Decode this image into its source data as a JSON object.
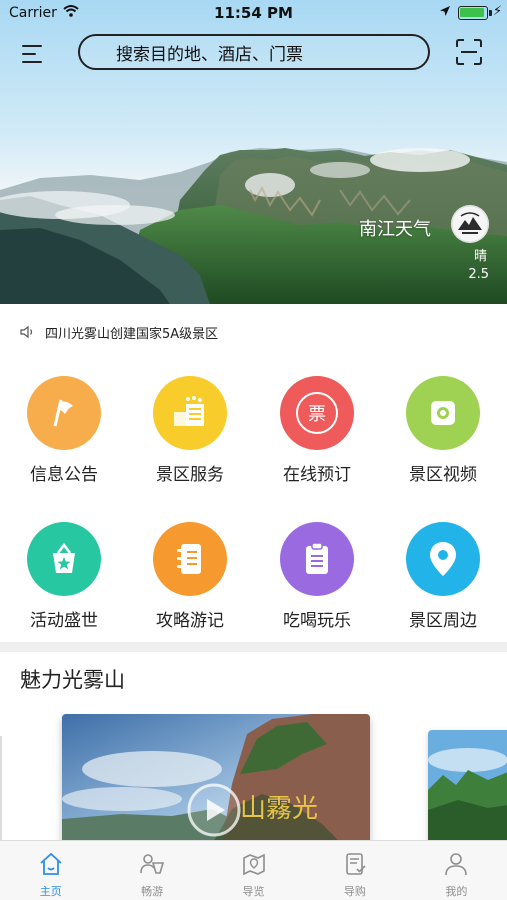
{
  "status_bar": {
    "carrier": "Carrier",
    "time": "11:54 PM"
  },
  "header": {
    "search_placeholder": "搜索目的地、酒店、门票"
  },
  "weather": {
    "city": "南江天气",
    "condition": "晴",
    "temperature": "2.5"
  },
  "notice": {
    "text": "四川光雾山创建国家5A级景区"
  },
  "grid": {
    "items": [
      {
        "label": "信息公告",
        "icon": "flag-icon",
        "color": "#f7ad4b"
      },
      {
        "label": "景区服务",
        "icon": "service-icon",
        "color": "#f8cc2a"
      },
      {
        "label": "在线预订",
        "icon": "ticket-icon",
        "color": "#ef5a5a"
      },
      {
        "label": "景区视频",
        "icon": "video-icon",
        "color": "#9fd253"
      },
      {
        "label": "活动盛世",
        "icon": "gift-icon",
        "color": "#27c7a2"
      },
      {
        "label": "攻略游记",
        "icon": "notebook-icon",
        "color": "#f6992e"
      },
      {
        "label": "吃喝玩乐",
        "icon": "clipboard-icon",
        "color": "#9a6be0"
      },
      {
        "label": "景区周边",
        "icon": "location-pin-icon",
        "color": "#22b4e8"
      }
    ],
    "ticket_char": "票"
  },
  "section": {
    "title": "魅力光雾山"
  },
  "carousel": {
    "card_text": "山霧光"
  },
  "tabbar": {
    "tabs": [
      {
        "label": "主页",
        "icon": "home-icon",
        "active": true
      },
      {
        "label": "畅游",
        "icon": "tour-icon",
        "active": false
      },
      {
        "label": "导览",
        "icon": "map-guide-icon",
        "active": false
      },
      {
        "label": "导购",
        "icon": "shopping-guide-icon",
        "active": false
      },
      {
        "label": "我的",
        "icon": "profile-icon",
        "active": false
      }
    ]
  },
  "colors": {
    "accent": "#2d8ee8",
    "tab_inactive": "#8e8e8e"
  }
}
